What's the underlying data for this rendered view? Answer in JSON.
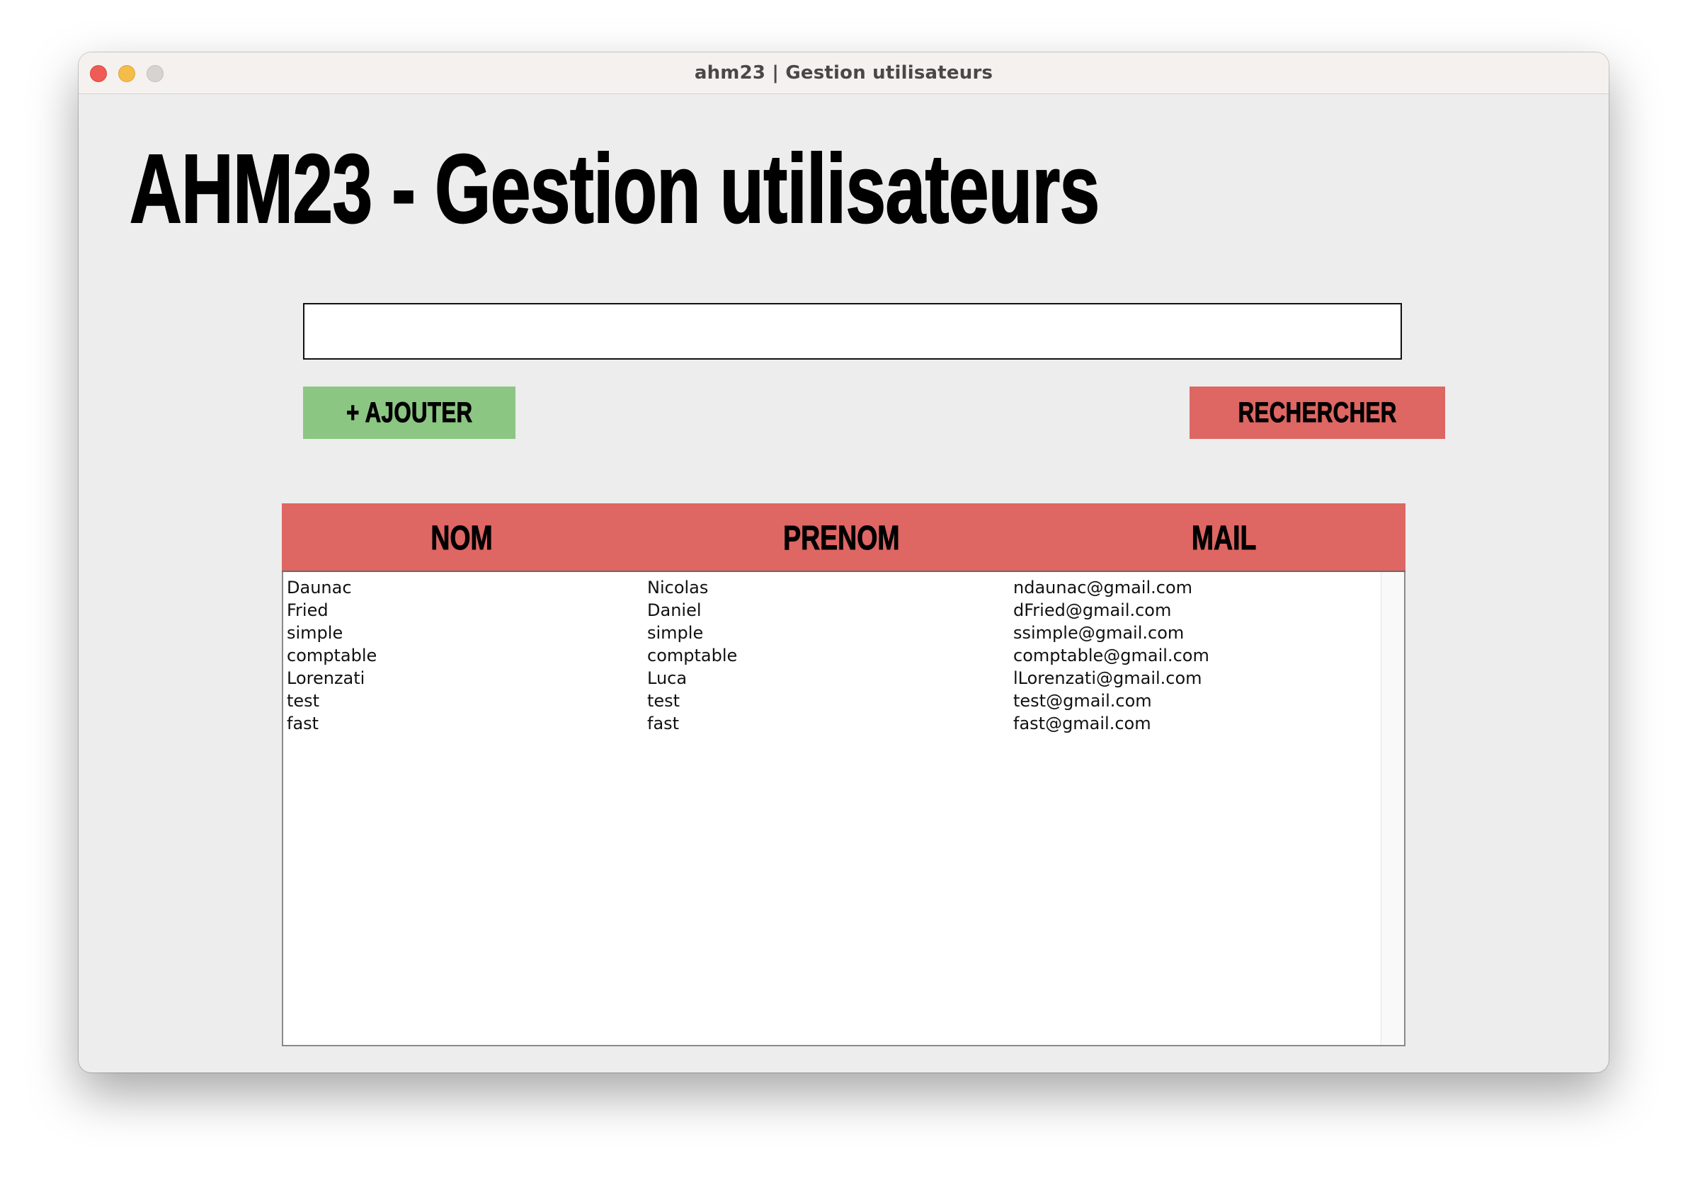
{
  "window": {
    "title": "ahm23 | Gestion utilisateurs"
  },
  "page": {
    "heading": "AHM23 - Gestion utilisateurs"
  },
  "search": {
    "value": "",
    "placeholder": ""
  },
  "buttons": {
    "add_label": "+ AJOUTER",
    "search_label": "RECHERCHER"
  },
  "table": {
    "columns": [
      "NOM",
      "PRENOM",
      "MAIL"
    ],
    "rows": [
      [
        "Daunac",
        "Nicolas",
        "ndaunac@gmail.com"
      ],
      [
        "Fried",
        "Daniel",
        "dFried@gmail.com"
      ],
      [
        "simple",
        "simple",
        "ssimple@gmail.com"
      ],
      [
        "comptable",
        "comptable",
        "comptable@gmail.com"
      ],
      [
        "Lorenzati",
        "Luca",
        "lLorenzati@gmail.com"
      ],
      [
        "test",
        "test",
        "test@gmail.com"
      ],
      [
        "fast",
        "fast",
        "fast@gmail.com"
      ]
    ]
  },
  "colors": {
    "add_button": "#8cc683",
    "accent_red": "#de6663",
    "window_bg": "#ededed",
    "titlebar_bg": "#f5f1ef"
  },
  "icons": {
    "close": "close-traffic-light-icon",
    "minimize": "minimize-traffic-light-icon",
    "maximize": "maximize-traffic-light-icon"
  }
}
